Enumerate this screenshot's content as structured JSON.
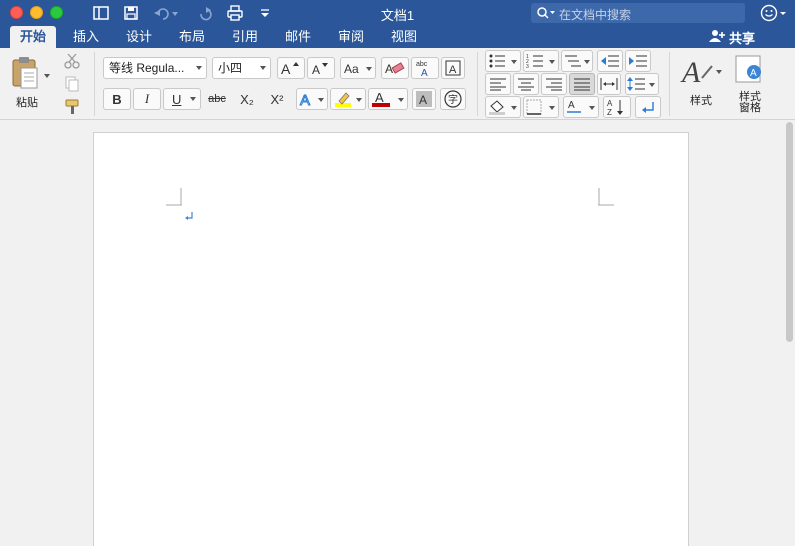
{
  "window": {
    "title": "文档1"
  },
  "search": {
    "placeholder": "在文档中搜索"
  },
  "tabs": [
    "开始",
    "插入",
    "设计",
    "布局",
    "引用",
    "邮件",
    "审阅",
    "视图"
  ],
  "share": {
    "label": "共享"
  },
  "clipboard": {
    "paste_label": "粘贴"
  },
  "font": {
    "name": "等线 Regula...",
    "size": "小四"
  },
  "styles": {
    "label": "样式",
    "pane_label_line1": "样式",
    "pane_label_line2": "窗格"
  },
  "format_buttons": {
    "bold": "B",
    "italic": "I",
    "underline": "U",
    "strike": "abc",
    "subscript": "X₂",
    "superscript": "X²"
  },
  "colors": {
    "titlebar": "#2b579a",
    "highlight": "#ffff00",
    "font_color": "#c00000"
  }
}
